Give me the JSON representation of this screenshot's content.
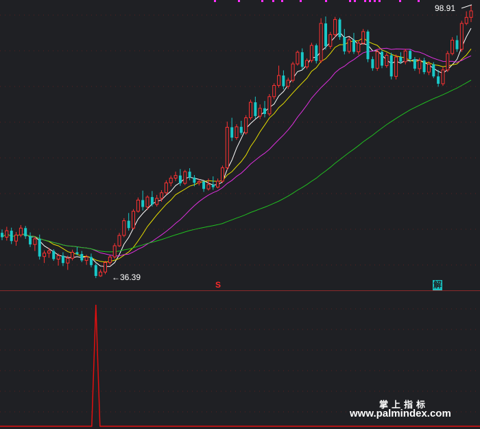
{
  "chart_data": {
    "type": "candlestick",
    "price_labels": {
      "high": "98.91",
      "low": "36.39"
    },
    "signals": {
      "buy": "S",
      "sell": "解"
    },
    "candles": [
      [
        46.0,
        46.8,
        44.3,
        45.0
      ],
      [
        45.0,
        47.4,
        44.2,
        46.5
      ],
      [
        46.5,
        47.2,
        43.4,
        44.1
      ],
      [
        44.1,
        46.2,
        43.0,
        45.5
      ],
      [
        45.5,
        47.8,
        45.0,
        47.1
      ],
      [
        47.1,
        47.6,
        44.6,
        45.2
      ],
      [
        45.2,
        46.1,
        42.7,
        43.3
      ],
      [
        43.3,
        45.2,
        41.8,
        44.6
      ],
      [
        44.6,
        45.6,
        39.8,
        40.5
      ],
      [
        40.5,
        41.9,
        39.0,
        41.3
      ],
      [
        41.3,
        42.5,
        40.2,
        41.8
      ],
      [
        41.8,
        42.2,
        39.5,
        39.9
      ],
      [
        39.9,
        41.2,
        38.4,
        40.7
      ],
      [
        40.7,
        41.5,
        38.3,
        39.0
      ],
      [
        39.0,
        40.7,
        37.4,
        40.1
      ],
      [
        40.1,
        42.1,
        39.6,
        41.5
      ],
      [
        41.5,
        42.7,
        40.8,
        41.1
      ],
      [
        41.1,
        41.8,
        39.2,
        39.6
      ],
      [
        39.6,
        40.9,
        38.6,
        40.4
      ],
      [
        40.4,
        41.2,
        38.0,
        38.5
      ],
      [
        38.5,
        38.9,
        35.5,
        36.0
      ],
      [
        36.0,
        37.5,
        35.8,
        36.9
      ],
      [
        36.9,
        39.5,
        36.4,
        39.1
      ],
      [
        39.1,
        40.8,
        38.6,
        40.4
      ],
      [
        40.4,
        43.6,
        40.0,
        43.0
      ],
      [
        43.0,
        46.0,
        42.7,
        45.4
      ],
      [
        45.4,
        49.4,
        45.0,
        48.8
      ],
      [
        48.8,
        50.6,
        46.5,
        47.1
      ],
      [
        47.1,
        51.5,
        46.8,
        51.0
      ],
      [
        51.0,
        54.2,
        50.7,
        53.6
      ],
      [
        53.6,
        55.8,
        51.2,
        52.0
      ],
      [
        52.0,
        54.7,
        51.3,
        54.3
      ],
      [
        54.3,
        55.7,
        52.1,
        52.6
      ],
      [
        52.6,
        54.8,
        52.1,
        54.0
      ],
      [
        54.0,
        55.9,
        53.2,
        55.3
      ],
      [
        55.3,
        58.2,
        54.8,
        57.6
      ],
      [
        57.6,
        59.3,
        56.8,
        58.7
      ],
      [
        58.7,
        60.2,
        58.0,
        59.3
      ],
      [
        59.3,
        60.8,
        56.9,
        57.5
      ],
      [
        57.5,
        60.6,
        57.1,
        60.2
      ],
      [
        60.2,
        61.0,
        58.2,
        58.8
      ],
      [
        58.8,
        59.4,
        56.8,
        57.6
      ],
      [
        57.6,
        58.5,
        57.0,
        57.9
      ],
      [
        57.9,
        58.1,
        55.5,
        56.2
      ],
      [
        56.2,
        58.6,
        55.8,
        57.2
      ],
      [
        57.2,
        59.1,
        56.0,
        56.6
      ],
      [
        56.6,
        58.6,
        56.3,
        58.0
      ],
      [
        58.0,
        61.6,
        57.6,
        61.1
      ],
      [
        61.1,
        71.8,
        60.6,
        70.5
      ],
      [
        70.5,
        72.7,
        67.3,
        68.1
      ],
      [
        68.1,
        71.2,
        67.6,
        70.6
      ],
      [
        70.6,
        72.0,
        68.7,
        69.2
      ],
      [
        69.2,
        73.3,
        68.8,
        72.7
      ],
      [
        72.7,
        76.9,
        72.2,
        76.3
      ],
      [
        76.3,
        77.6,
        72.5,
        73.1
      ],
      [
        73.1,
        75.8,
        72.4,
        74.9
      ],
      [
        74.9,
        76.6,
        72.8,
        73.6
      ],
      [
        73.6,
        78.2,
        73.1,
        77.6
      ],
      [
        77.6,
        80.7,
        77.0,
        80.2
      ],
      [
        80.2,
        84.8,
        79.7,
        82.5
      ],
      [
        82.5,
        83.7,
        79.3,
        80.0
      ],
      [
        80.0,
        82.0,
        79.4,
        81.4
      ],
      [
        81.4,
        85.7,
        80.9,
        85.2
      ],
      [
        85.2,
        88.3,
        84.8,
        87.9
      ],
      [
        87.9,
        88.8,
        83.8,
        84.5
      ],
      [
        84.5,
        86.5,
        84.0,
        86.0
      ],
      [
        86.0,
        90.1,
        85.5,
        89.5
      ],
      [
        89.5,
        89.9,
        85.3,
        85.9
      ],
      [
        85.9,
        95.8,
        85.4,
        94.6
      ],
      [
        94.6,
        96.2,
        88.5,
        89.3
      ],
      [
        89.3,
        92.6,
        88.7,
        92.0
      ],
      [
        92.0,
        96.1,
        91.3,
        95.5
      ],
      [
        95.5,
        95.9,
        90.8,
        91.4
      ],
      [
        91.4,
        93.3,
        87.4,
        88.1
      ],
      [
        88.1,
        91.4,
        87.6,
        90.8
      ],
      [
        90.8,
        92.4,
        87.5,
        88.0
      ],
      [
        88.0,
        90.7,
        87.3,
        90.0
      ],
      [
        90.0,
        93.3,
        89.6,
        92.7
      ],
      [
        92.7,
        93.1,
        85.6,
        86.3
      ],
      [
        86.3,
        86.9,
        83.6,
        84.2
      ],
      [
        84.2,
        88.6,
        83.6,
        88.0
      ],
      [
        88.0,
        88.4,
        84.2,
        84.8
      ],
      [
        84.8,
        87.8,
        84.3,
        87.2
      ],
      [
        87.2,
        87.8,
        81.6,
        82.3
      ],
      [
        82.3,
        87.4,
        81.6,
        86.8
      ],
      [
        86.8,
        87.9,
        85.2,
        85.7
      ],
      [
        85.7,
        88.7,
        85.1,
        88.2
      ],
      [
        88.2,
        88.6,
        85.6,
        86.3
      ],
      [
        86.3,
        86.8,
        83.6,
        84.1
      ],
      [
        84.1,
        86.6,
        82.9,
        86.0
      ],
      [
        86.0,
        86.6,
        82.8,
        83.3
      ],
      [
        83.3,
        85.8,
        82.6,
        85.1
      ],
      [
        85.1,
        85.6,
        81.9,
        82.3
      ],
      [
        82.3,
        83.8,
        79.9,
        80.6
      ],
      [
        80.6,
        84.5,
        80.1,
        83.8
      ],
      [
        83.8,
        88.2,
        83.3,
        87.6
      ],
      [
        87.6,
        91.4,
        87.2,
        90.7
      ],
      [
        90.7,
        91.8,
        88.0,
        88.6
      ],
      [
        88.6,
        95.2,
        88.0,
        94.6
      ],
      [
        94.6,
        97.4,
        94.2,
        96.0
      ],
      [
        96.0,
        98.9,
        94.9,
        97.5
      ]
    ],
    "moving_averages": [
      {
        "color": "#ffffff",
        "period": 5
      },
      {
        "color": "#e8e000",
        "period": 10
      },
      {
        "color": "#e030e0",
        "period": 20
      },
      {
        "color": "#20c020",
        "period": 60
      }
    ],
    "indicator": {
      "color": "#e01010",
      "spike_index": 20
    }
  },
  "colors": {
    "background": "#1f2024",
    "up": "#ff3232",
    "down": "#19c8c8",
    "grid": "#5a2020"
  },
  "watermark": {
    "cn": "掌上指标",
    "url": "www.palmindex.com"
  }
}
